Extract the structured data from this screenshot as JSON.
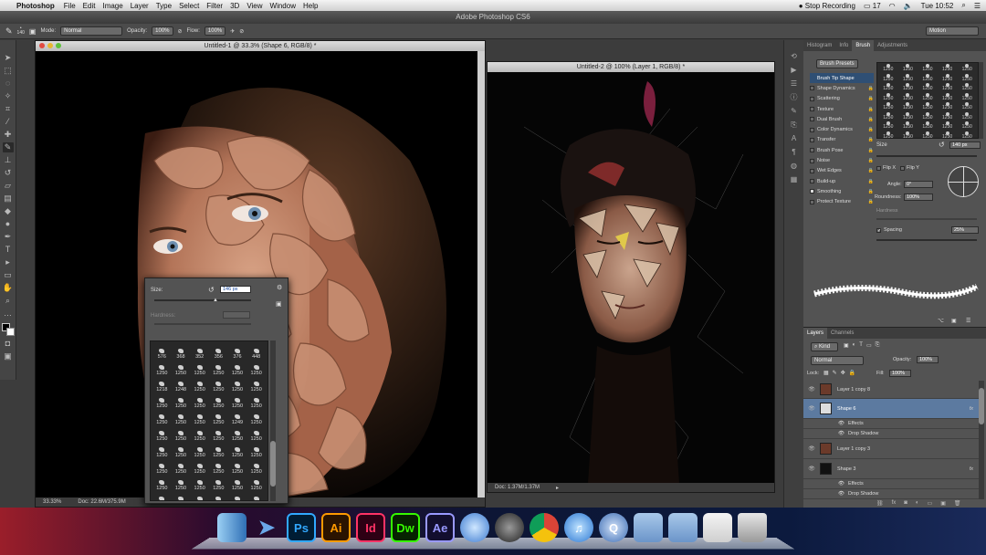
{
  "menubar": {
    "app_name": "Photoshop",
    "items": [
      "File",
      "Edit",
      "Image",
      "Layer",
      "Type",
      "Select",
      "Filter",
      "3D",
      "View",
      "Window",
      "Help"
    ],
    "status_recording": "Stop Recording",
    "battery_count": "17",
    "clock": "Tue 10:52"
  },
  "window_title": "Adobe Photoshop CS6",
  "options_bar": {
    "brush_size": "140",
    "mode_label": "Mode:",
    "mode_value": "Normal",
    "opacity_label": "Opacity:",
    "opacity_value": "100%",
    "flow_label": "Flow:",
    "flow_value": "100%",
    "workspace": "Motion"
  },
  "doc1": {
    "title": "Untitled-1 @ 33.3% (Shape 6, RGB/8) *",
    "zoom": "33.33%",
    "doc_size": "Doc: 22.6M/375.9M"
  },
  "doc2": {
    "title": "Untitled-2 @ 100% (Layer 1, RGB/8) *",
    "doc_size": "Doc: 1.37M/1.37M"
  },
  "brush_picker": {
    "size_label": "Size:",
    "size_value": "146 px",
    "hardness_label": "Hardness:",
    "preset_sizes": [
      "576",
      "368",
      "352",
      "356",
      "376",
      "448",
      "1250",
      "1250",
      "1250",
      "1250",
      "1250",
      "1250",
      "1218",
      "1248",
      "1250",
      "1250",
      "1250",
      "1250",
      "1250",
      "1250",
      "1250",
      "1250",
      "1250",
      "1250",
      "1250",
      "1250",
      "1250",
      "1250",
      "1249",
      "1250",
      "1250",
      "1250",
      "1250",
      "1250",
      "1250",
      "1250",
      "1250",
      "1250",
      "1250",
      "1250",
      "1250",
      "1250",
      "1250",
      "1250",
      "1250",
      "1250",
      "1250",
      "1250",
      "1250",
      "1250",
      "1250",
      "1250",
      "1250",
      "1250",
      "1250",
      "1250",
      "1250",
      "1250",
      "1250",
      "1250",
      "1250",
      "1250",
      "829",
      "668",
      "724",
      "776"
    ]
  },
  "brush_panel": {
    "tabs": [
      "Histogram",
      "Info",
      "Brush",
      "Adjustments"
    ],
    "active_tab": "Brush",
    "presets_button": "Brush Presets",
    "items": [
      "Brush Tip Shape",
      "Shape Dynamics",
      "Scattering",
      "Texture",
      "Dual Brush",
      "Color Dynamics",
      "Transfer",
      "Brush Pose",
      "Noise",
      "Wet Edges",
      "Build-up",
      "Smoothing",
      "Protect Texture"
    ],
    "tip_size": "1250",
    "size_label": "Size",
    "size_value": "140 px",
    "flip_x": "Flip X",
    "flip_y": "Flip Y",
    "angle_label": "Angle:",
    "angle_value": "0°",
    "roundness_label": "Roundness:",
    "roundness_value": "100%",
    "hardness_label": "Hardness",
    "spacing_label": "Spacing",
    "spacing_value": "25%"
  },
  "layers_panel": {
    "tabs": [
      "Layers",
      "Channels"
    ],
    "kind": "Kind",
    "blend_mode": "Normal",
    "opacity_label": "Opacity:",
    "opacity_value": "100%",
    "lock_label": "Lock:",
    "fill_label": "Fill:",
    "fill_value": "100%",
    "layers": [
      {
        "name": "Layer 1 copy 8"
      },
      {
        "name": "Shape 6",
        "fx": "fx",
        "selected": true
      },
      {
        "name": "Effects",
        "sub": true
      },
      {
        "name": "Drop Shadow",
        "sub": true
      },
      {
        "name": "Layer 1 copy 3"
      },
      {
        "name": "Shape 3",
        "fx": "fx"
      },
      {
        "name": "Effects",
        "sub": true
      },
      {
        "name": "Drop Shadow",
        "sub": true
      }
    ]
  },
  "dock": {
    "apps": [
      "Finder",
      "Preview",
      "Ps",
      "Ai",
      "Id",
      "Dw",
      "Ae",
      "Mail",
      "Cinema 4D",
      "Chrome",
      "iTunes",
      "QuickTime",
      "Applications",
      "Documents",
      "Zip",
      "Trash"
    ]
  },
  "colors": {
    "accent": "#2f6fb5",
    "photoshop_blue": "#31a8ff",
    "illustrator": "#ff9a00",
    "indesign": "#ff3366",
    "dreamweaver": "#35fa00",
    "aftereffects": "#9999ff"
  }
}
